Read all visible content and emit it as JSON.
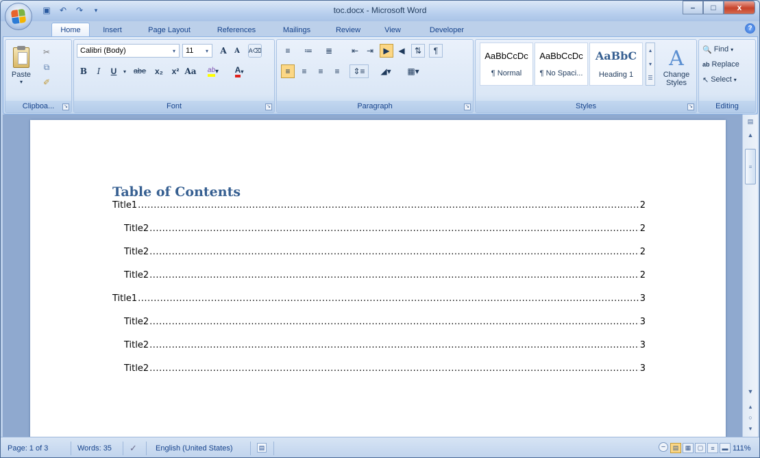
{
  "window": {
    "title": "toc.docx - Microsoft Word",
    "controls": {
      "minimize": "–",
      "maximize": "□",
      "close": "x"
    }
  },
  "qat": {
    "save_icon": "save-icon",
    "undo_icon": "undo-icon",
    "redo_icon": "redo-icon",
    "customize_icon": "customize-qat-icon"
  },
  "tabs": [
    {
      "label": "Home",
      "active": true
    },
    {
      "label": "Insert"
    },
    {
      "label": "Page Layout"
    },
    {
      "label": "References"
    },
    {
      "label": "Mailings"
    },
    {
      "label": "Review"
    },
    {
      "label": "View"
    },
    {
      "label": "Developer"
    }
  ],
  "ribbon": {
    "clipboard": {
      "label": "Clipboa...",
      "paste": "Paste"
    },
    "font": {
      "label": "Font",
      "font_name": "Calibri (Body)",
      "font_size": "11",
      "bold": "B",
      "italic": "I",
      "underline": "U",
      "strike": "abe",
      "subscript": "x₂",
      "superscript": "x²",
      "change_case": "Aa",
      "grow": "A",
      "shrink": "A"
    },
    "paragraph": {
      "label": "Paragraph"
    },
    "styles": {
      "label": "Styles",
      "items": [
        {
          "sample": "AaBbCcDc",
          "name": "¶ Normal"
        },
        {
          "sample": "AaBbCcDc",
          "name": "¶ No Spaci..."
        },
        {
          "sample": "AaBbC",
          "name": "Heading 1"
        }
      ],
      "change_styles": "Change Styles"
    },
    "editing": {
      "label": "Editing",
      "find": "Find",
      "replace": "Replace",
      "select": "Select"
    }
  },
  "document": {
    "heading": "Table of Contents",
    "entries": [
      {
        "text": "Title1",
        "page": "2",
        "level": 1
      },
      {
        "text": "Title2",
        "page": "2",
        "level": 2
      },
      {
        "text": "Title2",
        "page": "2",
        "level": 2
      },
      {
        "text": "Title2",
        "page": "2",
        "level": 2
      },
      {
        "text": "Title1",
        "page": "3",
        "level": 1
      },
      {
        "text": "Title2",
        "page": "3",
        "level": 2
      },
      {
        "text": "Title2",
        "page": "3",
        "level": 2
      },
      {
        "text": "Title2",
        "page": "3",
        "level": 2
      }
    ]
  },
  "status": {
    "page": "Page: 1 of 3",
    "words": "Words: 35",
    "language": "English (United States)",
    "zoom": "111%"
  },
  "colors": {
    "accent": "#365f91",
    "ribbon": "#dbe7f6",
    "frame": "#bcd0ea"
  }
}
